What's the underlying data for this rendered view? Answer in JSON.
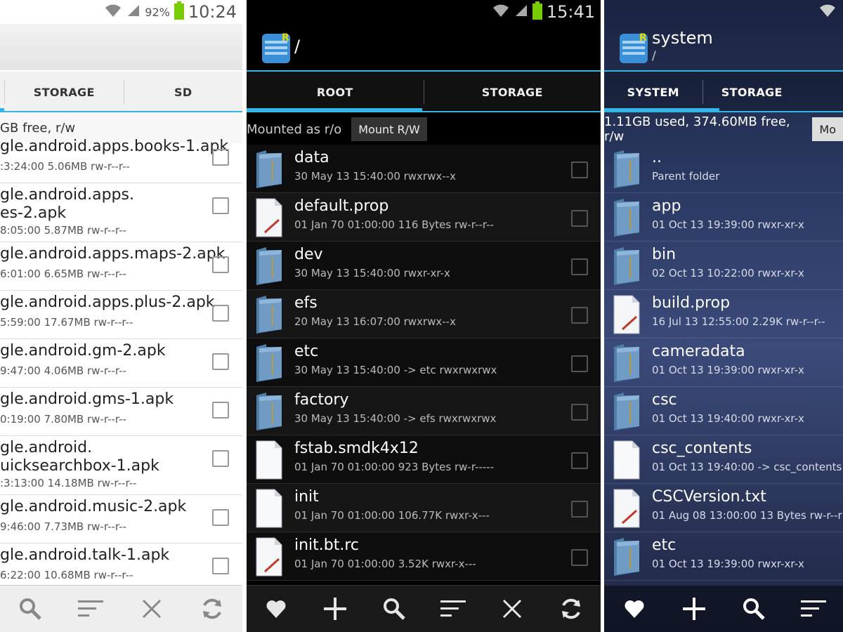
{
  "colors": {
    "accent": "#33b5e5",
    "folder": "#6f9bc4"
  },
  "panel1": {
    "status": {
      "battery_pct": "92%",
      "time": "10:24"
    },
    "tabs": [
      {
        "label": "STORAGE"
      },
      {
        "label": "SD"
      }
    ],
    "info": "GB free, r/w",
    "rows": [
      {
        "name1": "gle.android.apps.books-1.apk",
        "name2": "",
        "meta": ":3:24:00  5.06MB  rw-r--r--"
      },
      {
        "name1": "gle.android.apps.",
        "name2": "es-2.apk",
        "meta": "8:05:00  5.87MB  rw-r--r--"
      },
      {
        "name1": "gle.android.apps.maps-2.apk",
        "name2": "",
        "meta": "6:01:00  6.65MB  rw-r--r--"
      },
      {
        "name1": "gle.android.apps.plus-2.apk",
        "name2": "",
        "meta": "5:59:00  17.67MB  rw-r--r--"
      },
      {
        "name1": "gle.android.gm-2.apk",
        "name2": "",
        "meta": "9:47:00  4.06MB  rw-r--r--"
      },
      {
        "name1": "gle.android.gms-1.apk",
        "name2": "",
        "meta": "0:19:00  7.80MB  rw-r--r--"
      },
      {
        "name1": "gle.android.",
        "name2": "uicksearchbox-1.apk",
        "meta": ":3:13:00  14.18MB  rw-r--r--"
      },
      {
        "name1": "gle.android.music-2.apk",
        "name2": "",
        "meta": "9:46:00  7.73MB  rw-r--r--"
      },
      {
        "name1": "gle.android.talk-1.apk",
        "name2": "",
        "meta": "6:22:00  10.68MB  rw-r--r--"
      }
    ],
    "bottom_icons": [
      "search-icon",
      "sort-icon",
      "close-icon",
      "refresh-icon"
    ]
  },
  "panel2": {
    "status": {
      "time": "15:41"
    },
    "title": "/",
    "tabs": [
      {
        "label": "ROOT"
      },
      {
        "label": "STORAGE"
      }
    ],
    "info": "Mounted as r/o",
    "mount_button": "Mount R/W",
    "rows": [
      {
        "type": "folder",
        "name": "data",
        "meta": "30 May 13 15:40:00    rwxrwx--x"
      },
      {
        "type": "doc",
        "name": "default.prop",
        "meta": "01 Jan 70 01:00:00  116 Bytes  rw-r--r--"
      },
      {
        "type": "folder",
        "name": "dev",
        "meta": "30 May 13 15:40:00    rwxr-xr-x"
      },
      {
        "type": "folder",
        "name": "efs",
        "meta": "20 May 13 16:07:00    rwxrwx--x"
      },
      {
        "type": "folder",
        "name": "etc",
        "meta": "30 May 13 15:40:00  -> etc  rwxrwxrwx"
      },
      {
        "type": "folder",
        "name": "factory",
        "meta": "30 May 13 15:40:00  -> efs  rwxrwxrwx"
      },
      {
        "type": "file",
        "name": "fstab.smdk4x12",
        "meta": "01 Jan 70 01:00:00  923 Bytes  rw-r-----"
      },
      {
        "type": "file",
        "name": "init",
        "meta": "01 Jan 70 01:00:00  106.77K  rwxr-x---"
      },
      {
        "type": "doc",
        "name": "init.bt.rc",
        "meta": "01 Jan 70 01:00:00  3.52K  rwxr-x---"
      }
    ],
    "bottom_icons": [
      "heart-icon",
      "plus-icon",
      "search-icon",
      "sort-icon",
      "close-icon",
      "refresh-icon"
    ]
  },
  "panel3": {
    "title": "system",
    "subtitle": "/",
    "tabs": [
      {
        "label": "SYSTEM"
      },
      {
        "label": "STORAGE"
      }
    ],
    "info": "1.11GB used, 374.60MB free, r/w",
    "mount_button": "Mo",
    "rows": [
      {
        "type": "folder",
        "name": "..",
        "meta": "Parent folder"
      },
      {
        "type": "folder",
        "name": "app",
        "meta": "01 Oct 13 19:39:00    rwxr-xr-x"
      },
      {
        "type": "folder",
        "name": "bin",
        "meta": "02 Oct 13 10:22:00    rwxr-xr-x"
      },
      {
        "type": "doc",
        "name": "build.prop",
        "meta": "16 Jul 13 12:55:00  2.29K  rw-r--r--"
      },
      {
        "type": "folder",
        "name": "cameradata",
        "meta": "01 Oct 13 19:39:00    rwxr-xr-x"
      },
      {
        "type": "folder",
        "name": "csc",
        "meta": "01 Oct 13 19:40:00    rwxr-xr-x"
      },
      {
        "type": "file",
        "name": "csc_contents",
        "meta": "01 Oct 13 19:40:00  -> csc_contents"
      },
      {
        "type": "doc",
        "name": "CSCVersion.txt",
        "meta": "01 Aug 08 13:00:00  13 Bytes  rw-r--r"
      },
      {
        "type": "folder",
        "name": "etc",
        "meta": "01 Oct 13 19:39:00    rwxr-xr-x"
      }
    ],
    "bottom_icons": [
      "heart-icon",
      "plus-icon",
      "search-icon",
      "sort-icon"
    ]
  }
}
